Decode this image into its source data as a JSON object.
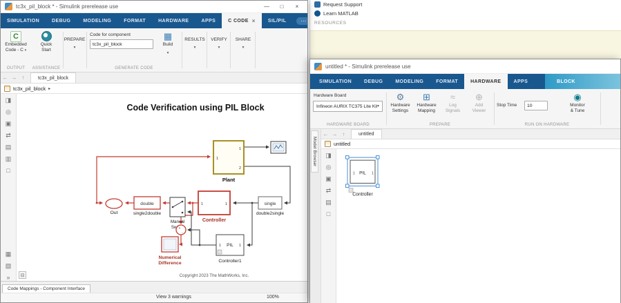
{
  "background": {
    "links": [
      {
        "label": "Request Support"
      },
      {
        "label": "Learn MATLAB"
      }
    ],
    "resources_label": "RESOURCES"
  },
  "glyphs": {
    "minimize": "—",
    "maximize": "□",
    "close": "×",
    "tab_close": "×",
    "overflow": "⋯",
    "chevron": "▾",
    "caret": "▸",
    "back": "←",
    "forward": "→",
    "up": "↑",
    "more": "»",
    "collapse": "⊟",
    "build": "▦"
  },
  "palette_icons": [
    {
      "glyph": "◨"
    },
    {
      "glyph": "◎"
    },
    {
      "glyph": "▣"
    },
    {
      "glyph": "⇄"
    },
    {
      "glyph": "▤"
    },
    {
      "glyph": "▥"
    },
    {
      "glyph": "□"
    }
  ],
  "palette_bottom": [
    {
      "glyph": "▦"
    },
    {
      "glyph": "▧"
    }
  ],
  "left_window": {
    "title": "tc3x_pil_block * - Simulink prerelease use",
    "tabs": [
      {
        "label": "SIMULATION"
      },
      {
        "label": "DEBUG"
      },
      {
        "label": "MODELING"
      },
      {
        "label": "FORMAT"
      },
      {
        "label": "HARDWARE"
      },
      {
        "label": "APPS"
      },
      {
        "label": "C CODE",
        "active": true
      },
      {
        "label": "SIL/PIL"
      }
    ],
    "toolstrip": {
      "output": {
        "icon_letter": "C",
        "line1": "Embedded",
        "line2": "Code - C",
        "section": "OUTPUT"
      },
      "assistance": {
        "line1": "Quick",
        "line2": "Start",
        "section": "ASSISTANCE"
      },
      "prepare_label": "PREPARE",
      "generate": {
        "field_label": "Code for component",
        "field_value": "tc3x_pil_block",
        "build_label": "Build",
        "section": "GENERATE CODE"
      },
      "results_label": "RESULTS",
      "verify_label": "VERIFY",
      "share_label": "SHARE"
    },
    "nav_tab": "tc3x_pil_block",
    "breadcrumb": "tc3x_pil_block",
    "canvas": {
      "title": "Code Verification using PIL Block",
      "copyright": "Copyright 2023 The MathWorks, Inc.",
      "blocks": {
        "plant": {
          "label": "Plant",
          "in1": "1",
          "out1": "1",
          "out2": "2"
        },
        "out_port": {
          "label": "Out"
        },
        "single2double": {
          "text": "double",
          "label": "single2double"
        },
        "manual_switch": {
          "line1": "Manual",
          "line2": "Switch"
        },
        "controller": {
          "label": "Controller",
          "in1": "1",
          "out1": "1"
        },
        "double2single": {
          "text": "single",
          "label": "double2single"
        },
        "sum": {
          "sign1": "+",
          "sign2": "-"
        },
        "numerical_difference": {
          "line1": "Numerical",
          "line2": "Difference"
        },
        "controller1": {
          "text": "PIL",
          "label": "Controller1",
          "in1": "1",
          "out1": "1"
        }
      }
    },
    "bottom_tab": "Code Mappings - Component Interface",
    "status": {
      "warnings": "View 3 warnings",
      "zoom": "100%"
    }
  },
  "right_window": {
    "title": "untitled * - Simulink prerelease use",
    "tabs": [
      {
        "label": "SIMULATION"
      },
      {
        "label": "DEBUG"
      },
      {
        "label": "MODELING"
      },
      {
        "label": "FORMAT"
      },
      {
        "label": "HARDWARE",
        "active": true
      },
      {
        "label": "APPS"
      },
      {
        "label": "BLOCK",
        "contextual": true
      }
    ],
    "toolstrip": {
      "hardware_board": {
        "label": "Hardware Board",
        "value": "Infineon AURIX TC375 Lite Kit",
        "section": "HARDWARE BOARD"
      },
      "prepare": {
        "section": "PREPARE",
        "buttons": [
          {
            "line1": "Hardware",
            "line2": "Settings",
            "icon": "⚙"
          },
          {
            "line1": "Hardware",
            "line2": "Mapping",
            "icon": "⊞"
          },
          {
            "line1": "Log",
            "line2": "Signals",
            "icon": "≈"
          },
          {
            "line1": "Add",
            "line2": "Viewer",
            "icon": "⊕"
          }
        ]
      },
      "run": {
        "stop_label": "Stop Time",
        "stop_value": "10",
        "icon": "◉",
        "line1": "Monitor",
        "line2": "& Tune",
        "section": "RUN ON HARDWARE"
      }
    },
    "model_browser": "Model Browser",
    "nav_tab": "untitled",
    "breadcrumb": "untitled",
    "canvas": {
      "block": {
        "text": "PIL",
        "label": "Controller",
        "in1": "1",
        "out1": "1"
      }
    }
  }
}
